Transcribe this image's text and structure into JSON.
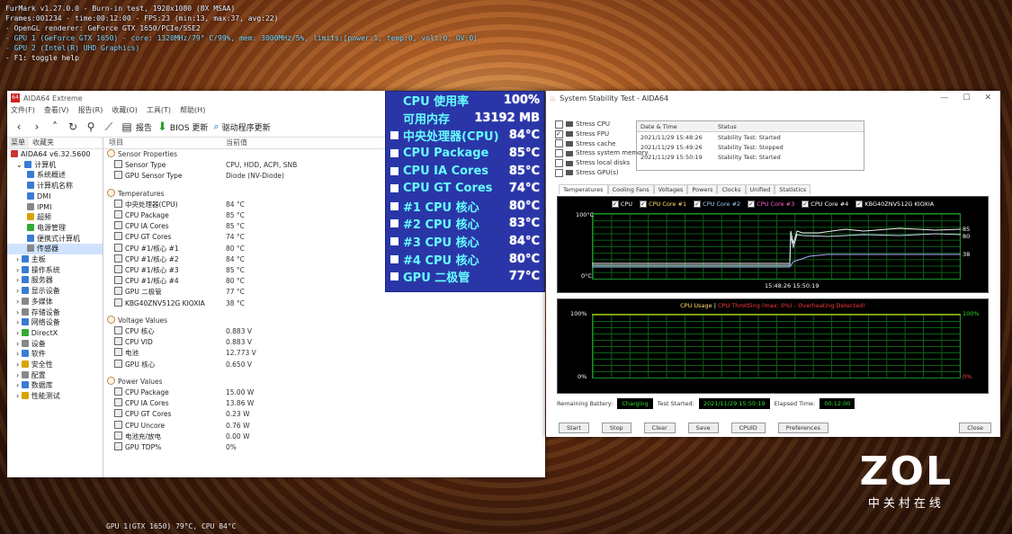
{
  "hud": {
    "line1": "FurMark v1.27.0.0 - Burn-in test, 1920x1080 (8X MSAA)",
    "line2": "Frames:001234 - time:00:12:00 - FPS:23 (min:13, max:37, avg:22)",
    "line3": "- OpenGL renderer: GeForce GTX 1650/PCIe/SSE2",
    "line4": "- GPU 1 (GeForce GTX 1650) - core: 1320MHz/79° C/99%, mem: 3000MHz/5%, limits:[power:1, temp:0, volt:0, OV:0]",
    "line5": "- GPU 2 (Intel(R) UHD Graphics)",
    "line6": "- F1: toggle help"
  },
  "bottom_hud": "GPU 1(GTX 1650) 79°C, CPU 84°C",
  "aida": {
    "title": "AIDA64 Extreme",
    "menu": [
      "文件(F)",
      "查看(V)",
      "报告(R)",
      "收藏(O)",
      "工具(T)",
      "帮助(H)"
    ],
    "toolbar": {
      "report": "报告",
      "bios": "BIOS 更新",
      "driver": "驱动程序更新"
    },
    "tabs": [
      "菜单",
      "收藏夹"
    ],
    "columns": [
      "项目",
      "当前值"
    ],
    "tree": [
      {
        "label": "AIDA64 v6.32.5600",
        "icon": "red",
        "indent": 0
      },
      {
        "label": "计算机",
        "icon": "blue",
        "indent": 1,
        "prefix": "⌄"
      },
      {
        "label": "系统概述",
        "icon": "blue",
        "indent": 3
      },
      {
        "label": "计算机名称",
        "icon": "blue",
        "indent": 3
      },
      {
        "label": "DMI",
        "icon": "blue",
        "indent": 3
      },
      {
        "label": "IPMI",
        "icon": "gray",
        "indent": 3
      },
      {
        "label": "超频",
        "icon": "yellow",
        "indent": 3
      },
      {
        "label": "电源管理",
        "icon": "green",
        "indent": 3
      },
      {
        "label": "便携式计算机",
        "icon": "blue",
        "indent": 3
      },
      {
        "label": "传感器",
        "icon": "gray",
        "indent": 3,
        "selected": true
      },
      {
        "label": "主板",
        "icon": "blue",
        "indent": 1,
        "prefix": "›"
      },
      {
        "label": "操作系统",
        "icon": "blue",
        "indent": 1,
        "prefix": "›"
      },
      {
        "label": "服务器",
        "icon": "blue",
        "indent": 1,
        "prefix": "›"
      },
      {
        "label": "显示设备",
        "icon": "blue",
        "indent": 1,
        "prefix": "›"
      },
      {
        "label": "多媒体",
        "icon": "gray",
        "indent": 1,
        "prefix": "›"
      },
      {
        "label": "存储设备",
        "icon": "gray",
        "indent": 1,
        "prefix": "›"
      },
      {
        "label": "网络设备",
        "icon": "blue",
        "indent": 1,
        "prefix": "›"
      },
      {
        "label": "DirectX",
        "icon": "green",
        "indent": 1,
        "prefix": "›"
      },
      {
        "label": "设备",
        "icon": "gray",
        "indent": 1,
        "prefix": "›"
      },
      {
        "label": "软件",
        "icon": "blue",
        "indent": 1,
        "prefix": "›"
      },
      {
        "label": "安全性",
        "icon": "yellow",
        "indent": 1,
        "prefix": "›"
      },
      {
        "label": "配置",
        "icon": "gray",
        "indent": 1,
        "prefix": "›"
      },
      {
        "label": "数据库",
        "icon": "blue",
        "indent": 1,
        "prefix": "›"
      },
      {
        "label": "性能测试",
        "icon": "yellow",
        "indent": 1,
        "prefix": "›"
      }
    ],
    "rows": [
      {
        "type": "group",
        "name": "Sensor Properties"
      },
      {
        "name": "Sensor Type",
        "value": "CPU, HDD, ACPI, SNB"
      },
      {
        "name": "GPU Sensor Type",
        "value": "Diode (NV-Diode)"
      },
      {
        "type": "gap"
      },
      {
        "type": "group",
        "name": "Temperatures"
      },
      {
        "name": "中央处理器(CPU)",
        "value": "84 °C"
      },
      {
        "name": "CPU Package",
        "value": "85 °C"
      },
      {
        "name": "CPU IA Cores",
        "value": "85 °C"
      },
      {
        "name": "CPU GT Cores",
        "value": "74 °C"
      },
      {
        "name": "CPU #1/核心 #1",
        "value": "80 °C"
      },
      {
        "name": "CPU #1/核心 #2",
        "value": "84 °C"
      },
      {
        "name": "CPU #1/核心 #3",
        "value": "85 °C"
      },
      {
        "name": "CPU #1/核心 #4",
        "value": "80 °C"
      },
      {
        "name": "GPU 二极管",
        "value": "77 °C"
      },
      {
        "name": "KBG40ZNV512G KIOXIA",
        "value": "38 °C"
      },
      {
        "type": "gap"
      },
      {
        "type": "group",
        "name": "Voltage Values"
      },
      {
        "name": "CPU 核心",
        "value": "0.883 V"
      },
      {
        "name": "CPU VID",
        "value": "0.883 V"
      },
      {
        "name": "电池",
        "value": "12.773 V"
      },
      {
        "name": "GPU 核心",
        "value": "0.650 V"
      },
      {
        "type": "gap"
      },
      {
        "type": "group",
        "name": "Power Values"
      },
      {
        "name": "CPU Package",
        "value": "15.00 W"
      },
      {
        "name": "CPU IA Cores",
        "value": "13.86 W"
      },
      {
        "name": "CPU GT Cores",
        "value": "0.23 W"
      },
      {
        "name": "CPU Uncore",
        "value": "0.76 W"
      },
      {
        "name": "电池充/放电",
        "value": "0.00 W"
      },
      {
        "name": "GPU TDP%",
        "value": "0%"
      }
    ]
  },
  "osd": [
    {
      "label": "CPU 使用率",
      "value": "100%",
      "checkbox": false
    },
    {
      "label": "可用内存",
      "value": "13192 MB",
      "checkbox": false
    },
    {
      "label": "中央处理器(CPU)",
      "value": "84°C",
      "checkbox": true
    },
    {
      "label": "CPU Package",
      "value": "85°C",
      "checkbox": true
    },
    {
      "label": "CPU IA Cores",
      "value": "85°C",
      "checkbox": true
    },
    {
      "label": "CPU GT Cores",
      "value": "74°C",
      "checkbox": true
    },
    {
      "label": "#1 CPU 核心",
      "value": "80°C",
      "checkbox": true
    },
    {
      "label": "#2 CPU 核心",
      "value": "83°C",
      "checkbox": true
    },
    {
      "label": "#3 CPU 核心",
      "value": "84°C",
      "checkbox": true
    },
    {
      "label": "#4 CPU 核心",
      "value": "80°C",
      "checkbox": true
    },
    {
      "label": "GPU 二极管",
      "value": "77°C",
      "checkbox": true
    }
  ],
  "sst": {
    "title": "System Stability Test - AIDA64",
    "stress": [
      {
        "label": "Stress CPU",
        "on": false
      },
      {
        "label": "Stress FPU",
        "on": true
      },
      {
        "label": "Stress cache",
        "on": false
      },
      {
        "label": "Stress system memory",
        "on": false
      },
      {
        "label": "Stress local disks",
        "on": false
      },
      {
        "label": "Stress GPU(s)",
        "on": false
      }
    ],
    "log_head": [
      "Date & Time",
      "Status"
    ],
    "log": [
      [
        "2021/11/29 15:48:26",
        "Stability Test: Started"
      ],
      [
        "2021/11/29 15:49:26",
        "Stability Test: Stopped"
      ],
      [
        "2021/11/29 15:50:19",
        "Stability Test: Started"
      ]
    ],
    "tabs": [
      "Temperatures",
      "Cooling Fans",
      "Voltages",
      "Powers",
      "Clocks",
      "Unified",
      "Statistics"
    ],
    "legend": [
      "CPU",
      "CPU Core #1",
      "CPU Core #2",
      "CPU Core #3",
      "CPU Core #4",
      "KBG40ZNV512G KIOXIA"
    ],
    "g1_top": "100°C",
    "g1_bottom": "0°C",
    "g1_r1": "85",
    "g1_r2": "80",
    "g1_r3": "38",
    "g1_x": "15:48:26 15:50:19",
    "g2_caption": "CPU Usage",
    "g2_caption_red": "CPU Throttling (max: 0%) - Overheating Detected!",
    "g2_top": "100%",
    "g2_bottom": "0%",
    "g2_rtop": "100%",
    "g2_rbottom": "0%",
    "status": {
      "battery_label": "Remaining Battery:",
      "battery": "Charging",
      "started_label": "Test Started:",
      "started": "2021/11/29 15:50:19",
      "elapsed_label": "Elapsed Time:",
      "elapsed": "00:12:00"
    },
    "buttons": [
      "Start",
      "Stop",
      "Clear",
      "Save",
      "CPUID",
      "Preferences",
      "Close"
    ]
  },
  "watermark": {
    "big": "ZOL",
    "small": "中关村在线"
  }
}
